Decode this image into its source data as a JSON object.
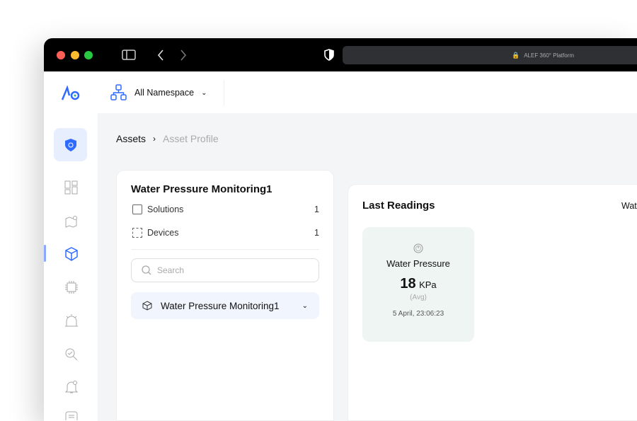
{
  "browser": {
    "url": "ALEF 360° Platform"
  },
  "header": {
    "namespace": "All Namespace"
  },
  "breadcrumb": {
    "items": [
      "Assets",
      "Asset Profile"
    ]
  },
  "asset": {
    "title": "Water Pressure Monitoring1",
    "stats": [
      {
        "label": "Solutions",
        "value": "1"
      },
      {
        "label": "Devices",
        "value": "1"
      }
    ],
    "search_placeholder": "Search",
    "tree_item": "Water Pressure Monitoring1"
  },
  "readings": {
    "title": "Last Readings",
    "right_label": "Wat",
    "cards": [
      {
        "name": "Water Pressure",
        "value": "18",
        "unit": "KPa",
        "agg": "(Avg)",
        "time": "5 April, 23:06:23"
      }
    ]
  },
  "colors": {
    "accent": "#2f6bff",
    "active_bg": "#e7efff",
    "reading_bg": "#eef5f3"
  }
}
